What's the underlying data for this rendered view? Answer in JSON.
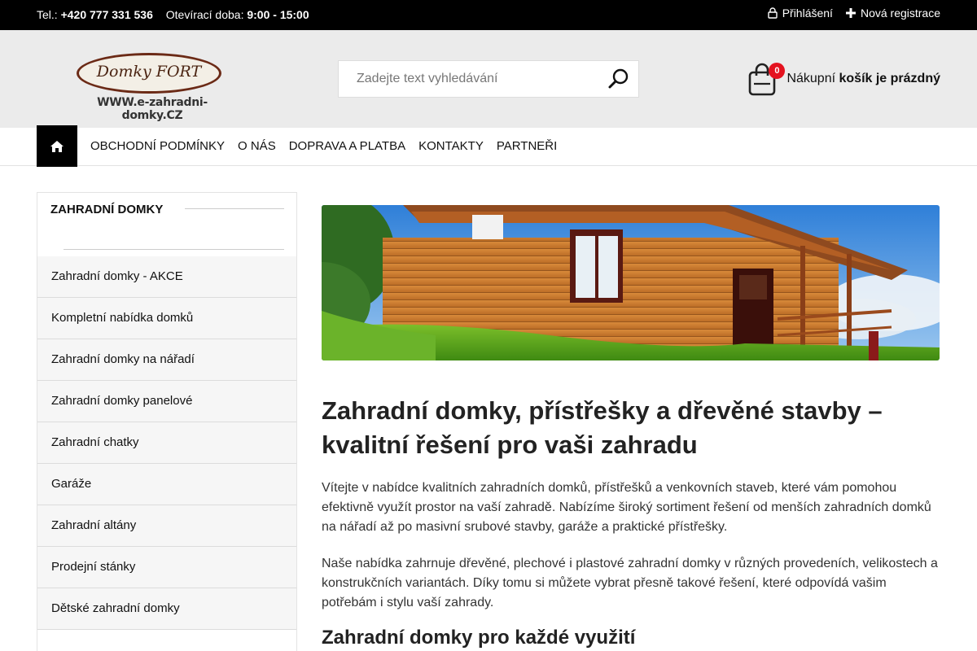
{
  "topbar": {
    "phone_label": "Tel.:",
    "phone": "+420 777 331 536",
    "hours_label": "Otevírací doba:",
    "hours": "9:00 - 15:00",
    "login": "Přihlášení",
    "register": "Nová registrace"
  },
  "logo": {
    "name": "Domky FORT",
    "url": "WWW.e-zahradni-domky.CZ"
  },
  "search": {
    "placeholder": "Zadejte text vyhledávání"
  },
  "cart": {
    "count": "0",
    "label": "Nákupní",
    "status": "košík je prázdný"
  },
  "nav": {
    "items": [
      "OBCHODNÍ PODMÍNKY",
      "O NÁS",
      "DOPRAVA A PLATBA",
      "KONTAKTY",
      "PARTNEŘI"
    ]
  },
  "sidebar": {
    "title": "ZAHRADNÍ DOMKY",
    "items": [
      "Zahradní domky - AKCE",
      "Kompletní nabídka domků",
      "Zahradní domky na nářadí",
      "Zahradní domky panelové",
      "Zahradní chatky",
      "Garáže",
      "Zahradní altány",
      "Prodejní stánky",
      "Dětské zahradní domky"
    ]
  },
  "main": {
    "title": "Zahradní domky, přístřešky a dřevěné stavby – kvalitní řešení pro vaši zahradu",
    "p1": "Vítejte v nabídce kvalitních zahradních domků, přístřešků a venkovních staveb, které vám pomohou efektivně využít prostor na vaší zahradě. Nabízíme široký sortiment řešení od menších zahradních domků na nářadí až po masivní srubové stavby, garáže a praktické přístřešky.",
    "p2": "Naše nabídka zahrnuje dřevěné, plechové i plastové zahradní domky v různých provedeních, velikostech a konstrukčních variantách. Díky tomu si můžete vybrat přesně takové řešení, které odpovídá vašim potřebám i stylu vaší zahrady.",
    "subtitle": "Zahradní domky pro každé využití"
  },
  "colors": {
    "topbar": "#000000",
    "header": "#ebebeb",
    "badge": "#e4121f",
    "logo_brown": "#6b2a16"
  }
}
